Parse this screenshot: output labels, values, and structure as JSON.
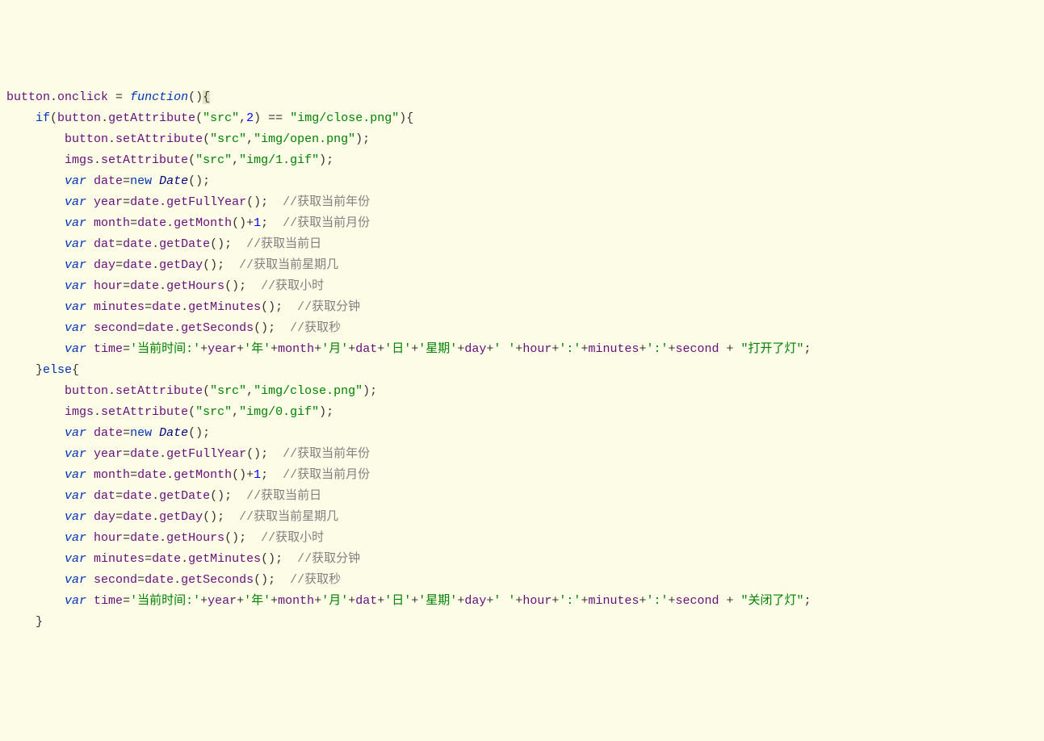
{
  "code": {
    "lines": [
      {
        "indent": 0,
        "tokens": [
          [
            "ident",
            "button"
          ],
          [
            "punc",
            "."
          ],
          [
            "ident",
            "onclick"
          ],
          [
            "punc",
            " = "
          ],
          [
            "kw",
            "function"
          ],
          [
            "punc",
            "()"
          ],
          [
            "hl",
            "{"
          ]
        ]
      },
      {
        "indent": 1,
        "tokens": [
          [
            "ctrl",
            "if"
          ],
          [
            "punc",
            "("
          ],
          [
            "ident",
            "button"
          ],
          [
            "punc",
            "."
          ],
          [
            "ident",
            "getAttribute"
          ],
          [
            "punc",
            "("
          ],
          [
            "str",
            "\"src\""
          ],
          [
            "punc",
            ","
          ],
          [
            "num",
            "2"
          ],
          [
            "punc",
            ") == "
          ],
          [
            "str",
            "\"img/close.png\""
          ],
          [
            "punc",
            "){"
          ]
        ]
      },
      {
        "indent": 2,
        "tokens": [
          [
            "ident",
            "button"
          ],
          [
            "punc",
            "."
          ],
          [
            "ident",
            "setAttribute"
          ],
          [
            "punc",
            "("
          ],
          [
            "str",
            "\"src\""
          ],
          [
            "punc",
            ","
          ],
          [
            "str",
            "\"img/open.png\""
          ],
          [
            "punc",
            ");"
          ]
        ]
      },
      {
        "indent": 2,
        "tokens": [
          [
            "ident",
            "imgs"
          ],
          [
            "punc",
            "."
          ],
          [
            "ident",
            "setAttribute"
          ],
          [
            "punc",
            "("
          ],
          [
            "str",
            "\"src\""
          ],
          [
            "punc",
            ","
          ],
          [
            "str",
            "\"img/1.gif\""
          ],
          [
            "punc",
            ");"
          ]
        ]
      },
      {
        "indent": 2,
        "tokens": [
          [
            "kw",
            "var"
          ],
          [
            "punc",
            " "
          ],
          [
            "ident",
            "date"
          ],
          [
            "punc",
            "="
          ],
          [
            "ctrl",
            "new"
          ],
          [
            "punc",
            " "
          ],
          [
            "type",
            "Date"
          ],
          [
            "punc",
            "();"
          ]
        ]
      },
      {
        "indent": 2,
        "tokens": [
          [
            "kw",
            "var"
          ],
          [
            "punc",
            " "
          ],
          [
            "ident",
            "year"
          ],
          [
            "punc",
            "="
          ],
          [
            "ident",
            "date"
          ],
          [
            "punc",
            "."
          ],
          [
            "ident",
            "getFullYear"
          ],
          [
            "punc",
            "();  "
          ],
          [
            "cmt",
            "//获取当前年份"
          ]
        ]
      },
      {
        "indent": 2,
        "tokens": [
          [
            "kw",
            "var"
          ],
          [
            "punc",
            " "
          ],
          [
            "ident",
            "month"
          ],
          [
            "punc",
            "="
          ],
          [
            "ident",
            "date"
          ],
          [
            "punc",
            "."
          ],
          [
            "ident",
            "getMonth"
          ],
          [
            "punc",
            "()+"
          ],
          [
            "num",
            "1"
          ],
          [
            "punc",
            ";  "
          ],
          [
            "cmt",
            "//获取当前月份"
          ]
        ]
      },
      {
        "indent": 2,
        "tokens": [
          [
            "kw",
            "var"
          ],
          [
            "punc",
            " "
          ],
          [
            "ident",
            "dat"
          ],
          [
            "punc",
            "="
          ],
          [
            "ident",
            "date"
          ],
          [
            "punc",
            "."
          ],
          [
            "ident",
            "getDate"
          ],
          [
            "punc",
            "();  "
          ],
          [
            "cmt",
            "//获取当前日"
          ]
        ]
      },
      {
        "indent": 2,
        "tokens": [
          [
            "kw",
            "var"
          ],
          [
            "punc",
            " "
          ],
          [
            "ident",
            "day"
          ],
          [
            "punc",
            "="
          ],
          [
            "ident",
            "date"
          ],
          [
            "punc",
            "."
          ],
          [
            "ident",
            "getDay"
          ],
          [
            "punc",
            "();  "
          ],
          [
            "cmt",
            "//获取当前星期几"
          ]
        ]
      },
      {
        "indent": 2,
        "tokens": [
          [
            "kw",
            "var"
          ],
          [
            "punc",
            " "
          ],
          [
            "ident",
            "hour"
          ],
          [
            "punc",
            "="
          ],
          [
            "ident",
            "date"
          ],
          [
            "punc",
            "."
          ],
          [
            "ident",
            "getHours"
          ],
          [
            "punc",
            "();  "
          ],
          [
            "cmt",
            "//获取小时"
          ]
        ]
      },
      {
        "indent": 2,
        "tokens": [
          [
            "kw",
            "var"
          ],
          [
            "punc",
            " "
          ],
          [
            "ident",
            "minutes"
          ],
          [
            "punc",
            "="
          ],
          [
            "ident",
            "date"
          ],
          [
            "punc",
            "."
          ],
          [
            "ident",
            "getMinutes"
          ],
          [
            "punc",
            "();  "
          ],
          [
            "cmt",
            "//获取分钟"
          ]
        ]
      },
      {
        "indent": 2,
        "tokens": [
          [
            "kw",
            "var"
          ],
          [
            "punc",
            " "
          ],
          [
            "ident",
            "second"
          ],
          [
            "punc",
            "="
          ],
          [
            "ident",
            "date"
          ],
          [
            "punc",
            "."
          ],
          [
            "ident",
            "getSeconds"
          ],
          [
            "punc",
            "();  "
          ],
          [
            "cmt",
            "//获取秒"
          ]
        ]
      },
      {
        "indent": 2,
        "tokens": [
          [
            "kw",
            "var"
          ],
          [
            "punc",
            " "
          ],
          [
            "ident",
            "time"
          ],
          [
            "punc",
            "="
          ],
          [
            "str",
            "'当前时间:'"
          ],
          [
            "punc",
            "+"
          ],
          [
            "ident",
            "year"
          ],
          [
            "punc",
            "+"
          ],
          [
            "str",
            "'年'"
          ],
          [
            "punc",
            "+"
          ],
          [
            "ident",
            "month"
          ],
          [
            "punc",
            "+"
          ],
          [
            "str",
            "'月'"
          ],
          [
            "punc",
            "+"
          ],
          [
            "ident",
            "dat"
          ],
          [
            "punc",
            "+"
          ],
          [
            "str",
            "'日'"
          ],
          [
            "punc",
            "+"
          ],
          [
            "str",
            "'星期'"
          ],
          [
            "punc",
            "+"
          ],
          [
            "ident",
            "day"
          ],
          [
            "punc",
            "+"
          ],
          [
            "str",
            "' '"
          ],
          [
            "punc",
            "+"
          ],
          [
            "ident",
            "hour"
          ],
          [
            "punc",
            "+"
          ],
          [
            "str",
            "':'"
          ],
          [
            "punc",
            "+"
          ],
          [
            "ident",
            "minutes"
          ],
          [
            "punc",
            "+"
          ],
          [
            "str",
            "':'"
          ],
          [
            "punc",
            "+"
          ],
          [
            "ident",
            "second"
          ],
          [
            "punc",
            " + "
          ],
          [
            "str",
            "\"打开了灯\""
          ],
          [
            "punc",
            ";"
          ]
        ]
      },
      {
        "indent": 1,
        "tokens": [
          [
            "punc",
            "}"
          ],
          [
            "ctrl",
            "else"
          ],
          [
            "punc",
            "{"
          ]
        ]
      },
      {
        "indent": 2,
        "tokens": [
          [
            "ident",
            "button"
          ],
          [
            "punc",
            "."
          ],
          [
            "ident",
            "setAttribute"
          ],
          [
            "punc",
            "("
          ],
          [
            "str",
            "\"src\""
          ],
          [
            "punc",
            ","
          ],
          [
            "str",
            "\"img/close.png\""
          ],
          [
            "punc",
            ");"
          ]
        ]
      },
      {
        "indent": 2,
        "tokens": [
          [
            "ident",
            "imgs"
          ],
          [
            "punc",
            "."
          ],
          [
            "ident",
            "setAttribute"
          ],
          [
            "punc",
            "("
          ],
          [
            "str",
            "\"src\""
          ],
          [
            "punc",
            ","
          ],
          [
            "str",
            "\"img/0.gif\""
          ],
          [
            "punc",
            ");"
          ]
        ]
      },
      {
        "indent": 2,
        "tokens": [
          [
            "kw",
            "var"
          ],
          [
            "punc",
            " "
          ],
          [
            "ident",
            "date"
          ],
          [
            "punc",
            "="
          ],
          [
            "ctrl",
            "new"
          ],
          [
            "punc",
            " "
          ],
          [
            "type",
            "Date"
          ],
          [
            "punc",
            "();"
          ]
        ]
      },
      {
        "indent": 2,
        "tokens": [
          [
            "kw",
            "var"
          ],
          [
            "punc",
            " "
          ],
          [
            "ident",
            "year"
          ],
          [
            "punc",
            "="
          ],
          [
            "ident",
            "date"
          ],
          [
            "punc",
            "."
          ],
          [
            "ident",
            "getFullYear"
          ],
          [
            "punc",
            "();  "
          ],
          [
            "cmt",
            "//获取当前年份"
          ]
        ]
      },
      {
        "indent": 2,
        "tokens": [
          [
            "kw",
            "var"
          ],
          [
            "punc",
            " "
          ],
          [
            "ident",
            "month"
          ],
          [
            "punc",
            "="
          ],
          [
            "ident",
            "date"
          ],
          [
            "punc",
            "."
          ],
          [
            "ident",
            "getMonth"
          ],
          [
            "punc",
            "()+"
          ],
          [
            "num",
            "1"
          ],
          [
            "punc",
            ";  "
          ],
          [
            "cmt",
            "//获取当前月份"
          ]
        ]
      },
      {
        "indent": 2,
        "tokens": [
          [
            "kw",
            "var"
          ],
          [
            "punc",
            " "
          ],
          [
            "ident",
            "dat"
          ],
          [
            "punc",
            "="
          ],
          [
            "ident",
            "date"
          ],
          [
            "punc",
            "."
          ],
          [
            "ident",
            "getDate"
          ],
          [
            "punc",
            "();  "
          ],
          [
            "cmt",
            "//获取当前日"
          ]
        ]
      },
      {
        "indent": 2,
        "tokens": [
          [
            "kw",
            "var"
          ],
          [
            "punc",
            " "
          ],
          [
            "ident",
            "day"
          ],
          [
            "punc",
            "="
          ],
          [
            "ident",
            "date"
          ],
          [
            "punc",
            "."
          ],
          [
            "ident",
            "getDay"
          ],
          [
            "punc",
            "();  "
          ],
          [
            "cmt",
            "//获取当前星期几"
          ]
        ]
      },
      {
        "indent": 2,
        "tokens": [
          [
            "kw",
            "var"
          ],
          [
            "punc",
            " "
          ],
          [
            "ident",
            "hour"
          ],
          [
            "punc",
            "="
          ],
          [
            "ident",
            "date"
          ],
          [
            "punc",
            "."
          ],
          [
            "ident",
            "getHours"
          ],
          [
            "punc",
            "();  "
          ],
          [
            "cmt",
            "//获取小时"
          ]
        ]
      },
      {
        "indent": 2,
        "tokens": [
          [
            "kw",
            "var"
          ],
          [
            "punc",
            " "
          ],
          [
            "ident",
            "minutes"
          ],
          [
            "punc",
            "="
          ],
          [
            "ident",
            "date"
          ],
          [
            "punc",
            "."
          ],
          [
            "ident",
            "getMinutes"
          ],
          [
            "punc",
            "();  "
          ],
          [
            "cmt",
            "//获取分钟"
          ]
        ]
      },
      {
        "indent": 2,
        "tokens": [
          [
            "kw",
            "var"
          ],
          [
            "punc",
            " "
          ],
          [
            "ident",
            "second"
          ],
          [
            "punc",
            "="
          ],
          [
            "ident",
            "date"
          ],
          [
            "punc",
            "."
          ],
          [
            "ident",
            "getSeconds"
          ],
          [
            "punc",
            "();  "
          ],
          [
            "cmt",
            "//获取秒"
          ]
        ]
      },
      {
        "indent": 2,
        "tokens": [
          [
            "kw",
            "var"
          ],
          [
            "punc",
            " "
          ],
          [
            "ident",
            "time"
          ],
          [
            "punc",
            "="
          ],
          [
            "str",
            "'当前时间:'"
          ],
          [
            "punc",
            "+"
          ],
          [
            "ident",
            "year"
          ],
          [
            "punc",
            "+"
          ],
          [
            "str",
            "'年'"
          ],
          [
            "punc",
            "+"
          ],
          [
            "ident",
            "month"
          ],
          [
            "punc",
            "+"
          ],
          [
            "str",
            "'月'"
          ],
          [
            "punc",
            "+"
          ],
          [
            "ident",
            "dat"
          ],
          [
            "punc",
            "+"
          ],
          [
            "str",
            "'日'"
          ],
          [
            "punc",
            "+"
          ],
          [
            "str",
            "'星期'"
          ],
          [
            "punc",
            "+"
          ],
          [
            "ident",
            "day"
          ],
          [
            "punc",
            "+"
          ],
          [
            "str",
            "' '"
          ],
          [
            "punc",
            "+"
          ],
          [
            "ident",
            "hour"
          ],
          [
            "punc",
            "+"
          ],
          [
            "str",
            "':'"
          ],
          [
            "punc",
            "+"
          ],
          [
            "ident",
            "minutes"
          ],
          [
            "punc",
            "+"
          ],
          [
            "str",
            "':'"
          ],
          [
            "punc",
            "+"
          ],
          [
            "ident",
            "second"
          ],
          [
            "punc",
            " + "
          ],
          [
            "str",
            "\"关闭了灯\""
          ],
          [
            "punc",
            ";"
          ]
        ]
      },
      {
        "indent": 1,
        "tokens": [
          [
            "punc",
            "}"
          ]
        ]
      }
    ],
    "indent_unit": "    "
  }
}
